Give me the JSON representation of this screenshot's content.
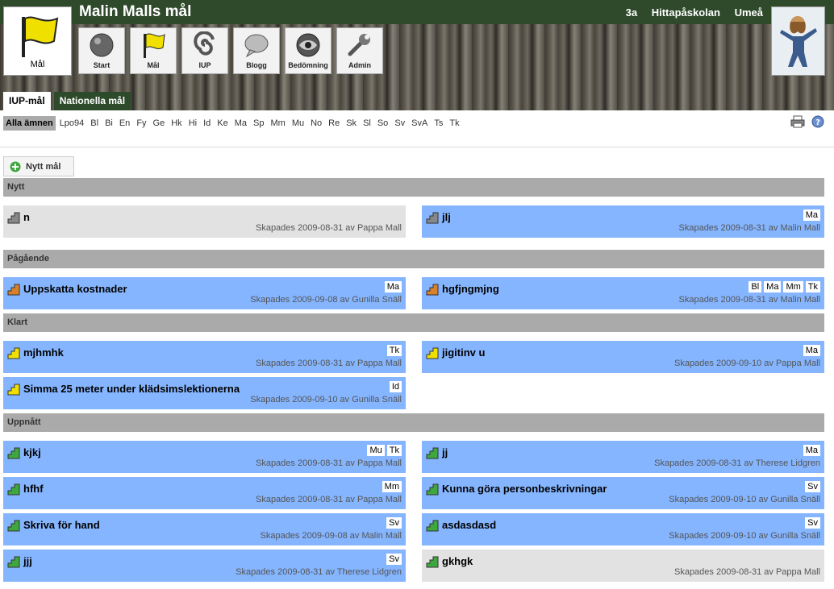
{
  "header": {
    "title": "Malin Malls mål",
    "class": "3a",
    "school": "Hittapåskolan",
    "city": "Umeå",
    "logo_label": "Mål"
  },
  "nav": [
    {
      "label": "Start",
      "icon": "ball-icon"
    },
    {
      "label": "Mål",
      "icon": "flag-icon"
    },
    {
      "label": "IUP",
      "icon": "spiral-icon"
    },
    {
      "label": "Blogg",
      "icon": "speech-bubble-icon"
    },
    {
      "label": "Bedömning",
      "icon": "eye-icon"
    },
    {
      "label": "Admin",
      "icon": "wrench-icon"
    }
  ],
  "tabs": [
    {
      "label": "IUP-mål",
      "active": true
    },
    {
      "label": "Nationella mål",
      "active": false
    }
  ],
  "subjects": [
    "Alla ämnen",
    "Lpo94",
    "Bl",
    "Bi",
    "En",
    "Fy",
    "Ge",
    "Hk",
    "Hi",
    "Id",
    "Ke",
    "Ma",
    "Sp",
    "Mm",
    "Mu",
    "No",
    "Re",
    "Sk",
    "Sl",
    "So",
    "Sv",
    "SvA",
    "Ts",
    "Tk"
  ],
  "new_goal_label": "Nytt mål",
  "sections": [
    {
      "label": "Nytt"
    },
    {
      "label": "Pågående"
    },
    {
      "label": "Klart"
    },
    {
      "label": "Uppnått"
    }
  ],
  "goals": [
    {
      "title": "n",
      "meta": "Skapades 2009-08-31 av Pappa Mall",
      "tags": [],
      "status": "grey"
    },
    {
      "title": "jlj",
      "meta": "Skapades 2009-08-31 av Malin Mall",
      "tags": [
        "Ma"
      ],
      "status": "grey"
    },
    {
      "title": "Uppskatta kostnader",
      "meta": "Skapades 2009-09-08 av Gunilla Snäll",
      "tags": [
        "Ma"
      ],
      "status": "orange"
    },
    {
      "title": "hgfjngmjng",
      "meta": "Skapades 2009-08-31 av Malin Mall",
      "tags": [
        "Bl",
        "Ma",
        "Mm",
        "Tk"
      ],
      "status": "orange"
    },
    {
      "title": "mjhmhk",
      "meta": "Skapades 2009-08-31 av Pappa Mall",
      "tags": [
        "Tk"
      ],
      "status": "yellow"
    },
    {
      "title": "jigitinv u",
      "meta": "Skapades 2009-09-10 av Pappa Mall",
      "tags": [
        "Ma"
      ],
      "status": "yellow"
    },
    {
      "title": "Simma 25 meter under klädsimslektionerna",
      "meta": "Skapades 2009-09-10 av Gunilla Snäll",
      "tags": [
        "Id"
      ],
      "status": "yellow"
    },
    {
      "title": "kjkj",
      "meta": "Skapades 2009-08-31 av Pappa Mall",
      "tags": [
        "Mu",
        "Tk"
      ],
      "status": "green"
    },
    {
      "title": "jj",
      "meta": "Skapades 2009-08-31 av Therese Lidgren",
      "tags": [
        "Ma"
      ],
      "status": "green"
    },
    {
      "title": "hfhf",
      "meta": "Skapades 2009-08-31 av Pappa Mall",
      "tags": [
        "Mm"
      ],
      "status": "green"
    },
    {
      "title": "Kunna göra personbeskrivningar",
      "meta": "Skapades 2009-09-10 av Gunilla Snäll",
      "tags": [
        "Sv"
      ],
      "status": "green"
    },
    {
      "title": "Skriva för hand",
      "meta": "Skapades 2009-09-08 av Malin Mall",
      "tags": [
        "Sv"
      ],
      "status": "green"
    },
    {
      "title": "asdasdasd",
      "meta": "Skapades 2009-09-10 av Gunilla Snäll",
      "tags": [
        "Sv"
      ],
      "status": "green"
    },
    {
      "title": "jjj",
      "meta": "Skapades 2009-08-31 av Therese Lidgren",
      "tags": [
        "Sv"
      ],
      "status": "green"
    },
    {
      "title": "gkhgk",
      "meta": "Skapades 2009-08-31 av Pappa Mall",
      "tags": [],
      "status": "green"
    }
  ]
}
